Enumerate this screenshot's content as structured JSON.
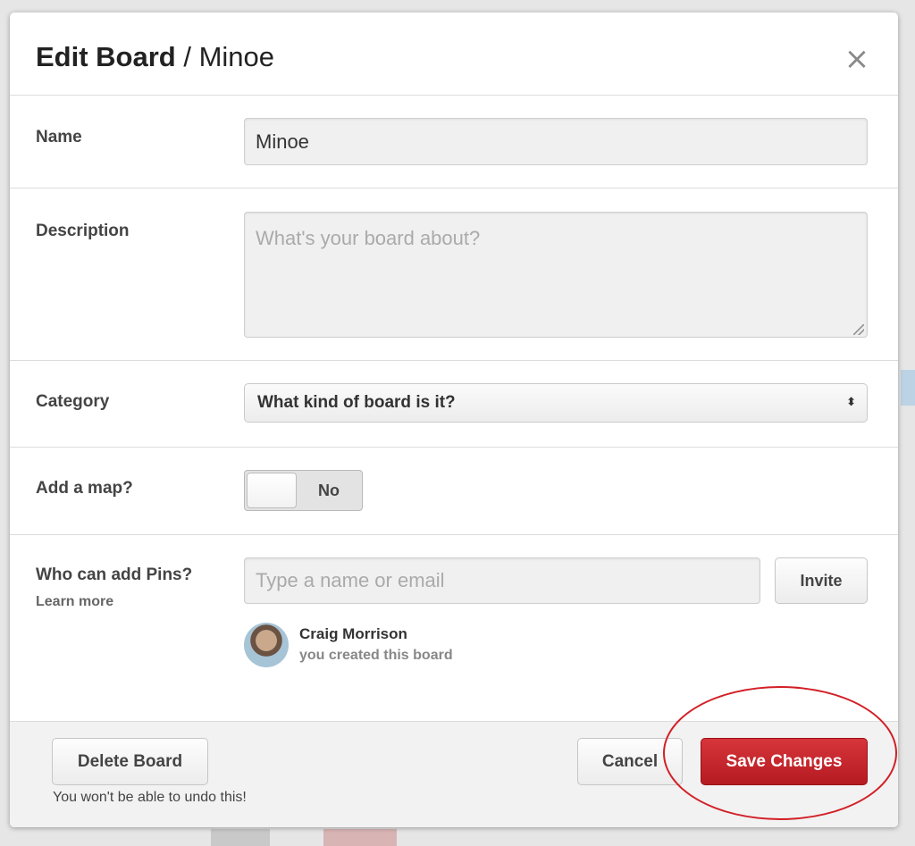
{
  "modal": {
    "title_strong": "Edit Board",
    "title_sep": " / ",
    "title_board": "Minoe",
    "close_symbol": "×"
  },
  "fields": {
    "name": {
      "label": "Name",
      "value": "Minoe"
    },
    "description": {
      "label": "Description",
      "placeholder": "What's your board about?",
      "value": ""
    },
    "category": {
      "label": "Category",
      "selected": "What kind of board is it?",
      "arrows": "⬍"
    },
    "map": {
      "label": "Add a map?",
      "toggle_value": "No"
    },
    "collaborators": {
      "label": "Who can add Pins?",
      "learn_more": "Learn more",
      "placeholder": "Type a name or email",
      "invite_label": "Invite",
      "members": [
        {
          "name": "Craig Morrison",
          "note": "you created this board"
        }
      ]
    }
  },
  "footer": {
    "delete_label": "Delete Board",
    "delete_warning": "You won't be able to undo this!",
    "cancel_label": "Cancel",
    "save_label": "Save Changes"
  },
  "colors": {
    "primary": "#c4262c",
    "highlight_ring": "#d21f26"
  }
}
